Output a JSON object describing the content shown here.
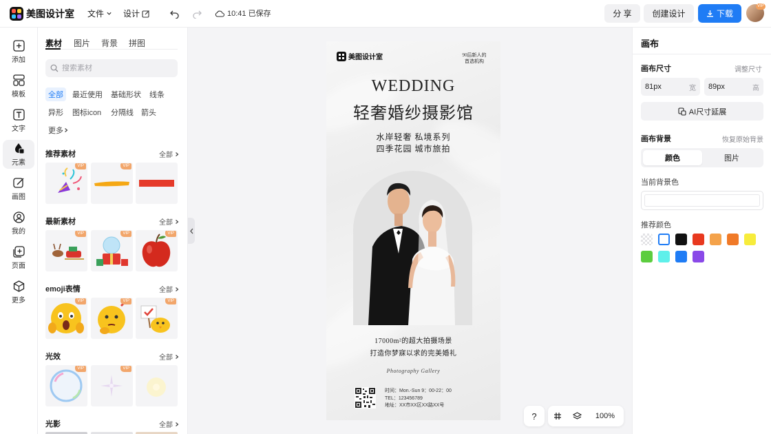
{
  "app": {
    "title": "美图设计室",
    "menu": {
      "file": "文件",
      "design": "设计"
    },
    "save_status": "10:41 已保存",
    "share_label": "分 享",
    "create_label": "创建设计",
    "download_label": "下载",
    "avatar_badge": "VIP"
  },
  "rail": {
    "items": [
      {
        "label": "添加",
        "icon": "plus-square-icon"
      },
      {
        "label": "模板",
        "icon": "template-icon"
      },
      {
        "label": "文字",
        "icon": "text-t-icon"
      },
      {
        "label": "元素",
        "icon": "shapes-icon"
      },
      {
        "label": "画图",
        "icon": "pen-edit-icon"
      },
      {
        "label": "我的",
        "icon": "user-icon"
      },
      {
        "label": "页面",
        "icon": "add-page-icon"
      },
      {
        "label": "更多",
        "icon": "cube-icon"
      }
    ],
    "active_index": 3
  },
  "assets": {
    "tabs": [
      "素材",
      "图片",
      "背景",
      "拼图"
    ],
    "active_tab": "素材",
    "search_placeholder": "搜索素材",
    "chips": [
      "全部",
      "最近使用",
      "基础形状",
      "线条",
      "异形",
      "图标icon",
      "分隔线",
      "箭头",
      "更多"
    ],
    "active_chip": "全部",
    "all_label": "全部",
    "vip_label": "VIP",
    "sections": [
      {
        "title": "推荐素材"
      },
      {
        "title": "最新素材"
      },
      {
        "title": "emoji表情"
      },
      {
        "title": "光效"
      },
      {
        "title": "光影"
      }
    ]
  },
  "poster": {
    "brand": "美图设计室",
    "corner_text": [
      "90后新人的",
      "首选机构"
    ],
    "headline_en": "WEDDING",
    "headline_cn": "轻奢婚纱摄影馆",
    "sub_line_1": "水岸轻奢 私境系列",
    "sub_line_2": "四季花园 城市旅拍",
    "body_line_1": "17000m²的超大拍摄场景",
    "body_line_2": "打造你梦寐以求的完美婚礼",
    "gallery": "Photography Gallery",
    "info_1": "时间：Mon.-Sun 9：00-22：00",
    "info_2": "TEL：123456789",
    "info_3": "地址：XX市XX区XX路XX号"
  },
  "canvas_tools": {
    "help": "?",
    "zoom": "100%"
  },
  "props": {
    "title": "画布",
    "size_label": "画布尺寸",
    "adjust_size": "调整尺寸",
    "width_value": "81px",
    "width_unit": "宽",
    "height_value": "89px",
    "height_unit": "高",
    "ai_extend_label": "AI尺寸延展",
    "bg_label": "画布背景",
    "restore_bg": "恢复原始背景",
    "seg_color": "颜色",
    "seg_image": "图片",
    "current_bg_label": "当前背景色",
    "recommended_label": "推荐颜色",
    "swatches": [
      "transparent",
      "#ffffff",
      "#111111",
      "#e8391f",
      "#f4a24a",
      "#f07a28",
      "#f7ec3c",
      "#5ccd3f",
      "#5ef0ea",
      "#1f7cf5",
      "#8a49e8"
    ],
    "selected_swatch_index": 1,
    "accent_color": "#1f7cf5"
  }
}
